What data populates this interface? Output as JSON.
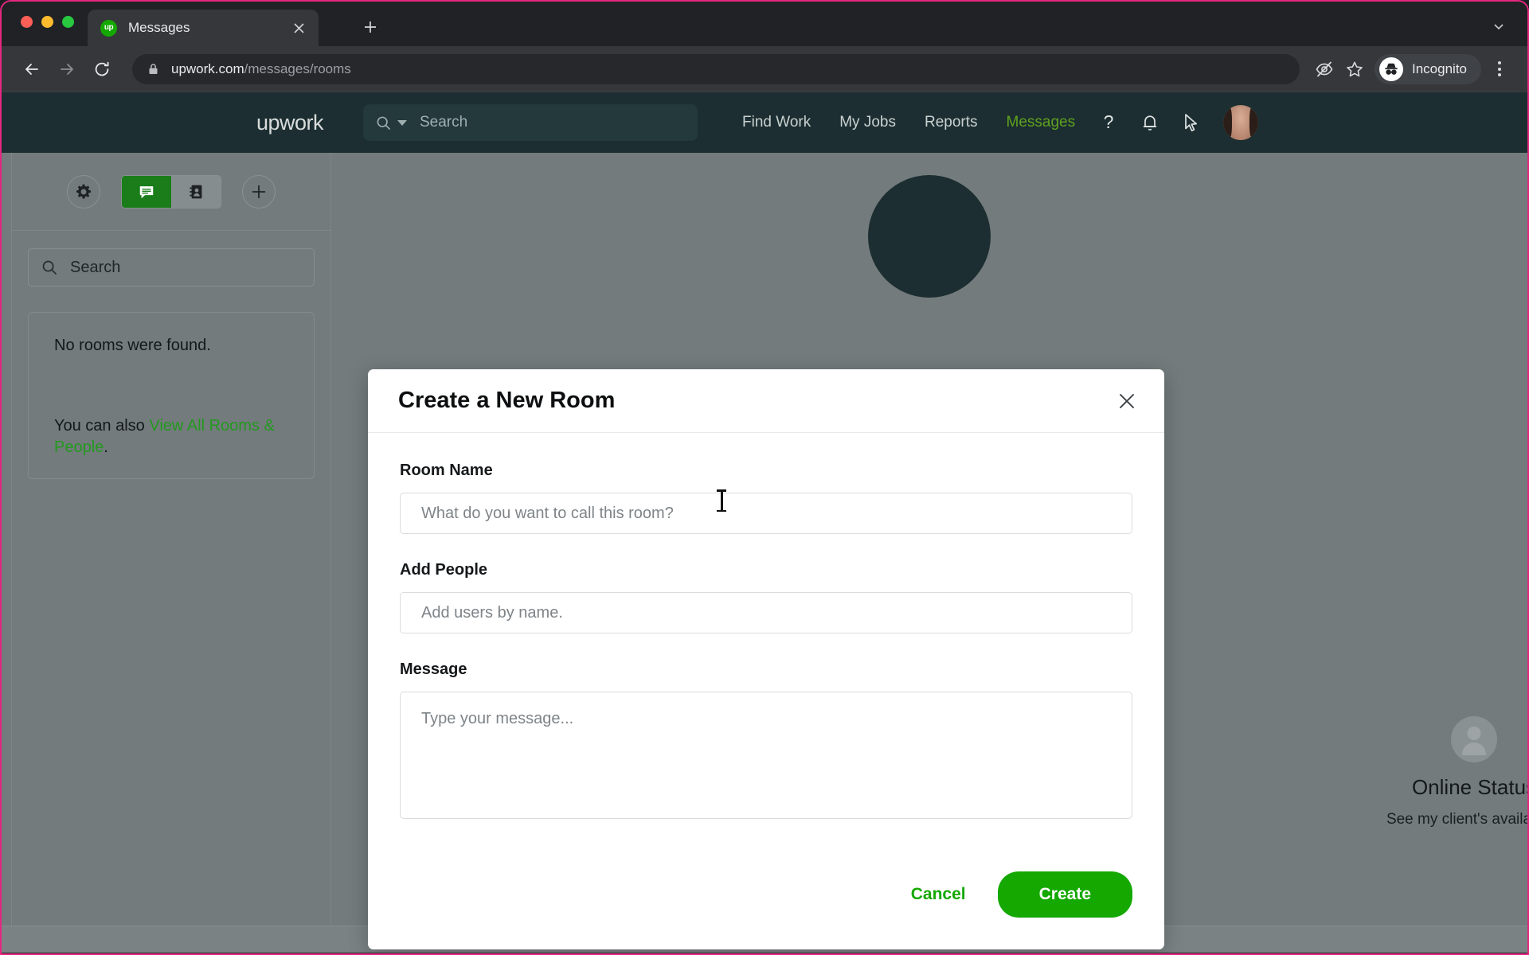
{
  "browser": {
    "tab": {
      "title": "Messages",
      "favicon_label": "up",
      "favicon_icon": "upwork-logo-icon",
      "close_icon": "close-icon"
    },
    "new_tab_icon": "plus-icon",
    "tab_list_chevron_icon": "chevron-down-icon",
    "toolbar": {
      "back_icon": "back-arrow-icon",
      "forward_icon": "forward-arrow-icon",
      "reload_icon": "reload-icon",
      "lock_icon": "lock-icon",
      "url_domain": "upwork.com",
      "url_path": "/messages/rooms",
      "url_full": "upwork.com/messages/rooms",
      "third_party_cookie_icon": "eye-slash-icon",
      "bookmark_icon": "star-icon",
      "incognito_label": "Incognito",
      "incognito_icon": "incognito-icon",
      "menu_icon": "three-dot-menu-icon"
    }
  },
  "site_header": {
    "logo_text": "upwork",
    "search": {
      "placeholder": "Search",
      "icon": "search-icon",
      "caret_icon": "chevron-down-icon"
    },
    "nav": [
      {
        "label": "Find Work",
        "active": false
      },
      {
        "label": "My Jobs",
        "active": false
      },
      {
        "label": "Reports",
        "active": false
      },
      {
        "label": "Messages",
        "active": true
      }
    ],
    "actions": [
      {
        "name": "help-icon",
        "glyph": "?"
      },
      {
        "name": "notifications-bell-icon",
        "glyph": "bell"
      },
      {
        "name": "cursor-pointer-icon",
        "glyph": "pointer"
      }
    ],
    "avatar_name": "user-avatar",
    "accent_color": "#5fa21e",
    "background_color": "#1c2e31"
  },
  "sidebar": {
    "settings_icon": "gear-icon",
    "toggle": [
      {
        "name": "rooms",
        "icon": "chat-bubble-icon",
        "selected": true
      },
      {
        "name": "people",
        "icon": "contact-card-icon",
        "selected": false
      }
    ],
    "add_button_icon": "plus-icon",
    "search": {
      "placeholder": "Search",
      "icon": "search-icon"
    },
    "empty_state": {
      "title": "No rooms were found.",
      "hint_prefix": "You can also ",
      "hint_link": "View All Rooms & People",
      "hint_suffix": "."
    }
  },
  "main": {
    "online_status": {
      "title": "Online Status",
      "subtitle": "See my client's availability",
      "avatar_icon": "person-placeholder-icon"
    }
  },
  "modal": {
    "title": "Create a New Room",
    "close_icon": "close-icon",
    "fields": [
      {
        "label": "Room Name",
        "value": "",
        "placeholder": "What do you want to call this room?",
        "type": "text"
      },
      {
        "label": "Add People",
        "value": "",
        "placeholder": "Add users by name.",
        "type": "text"
      }
    ],
    "message": {
      "label": "Message",
      "value": "",
      "placeholder": "Type your message..."
    },
    "cancel_label": "Cancel",
    "create_label": "Create",
    "primary_color": "#14a800"
  }
}
